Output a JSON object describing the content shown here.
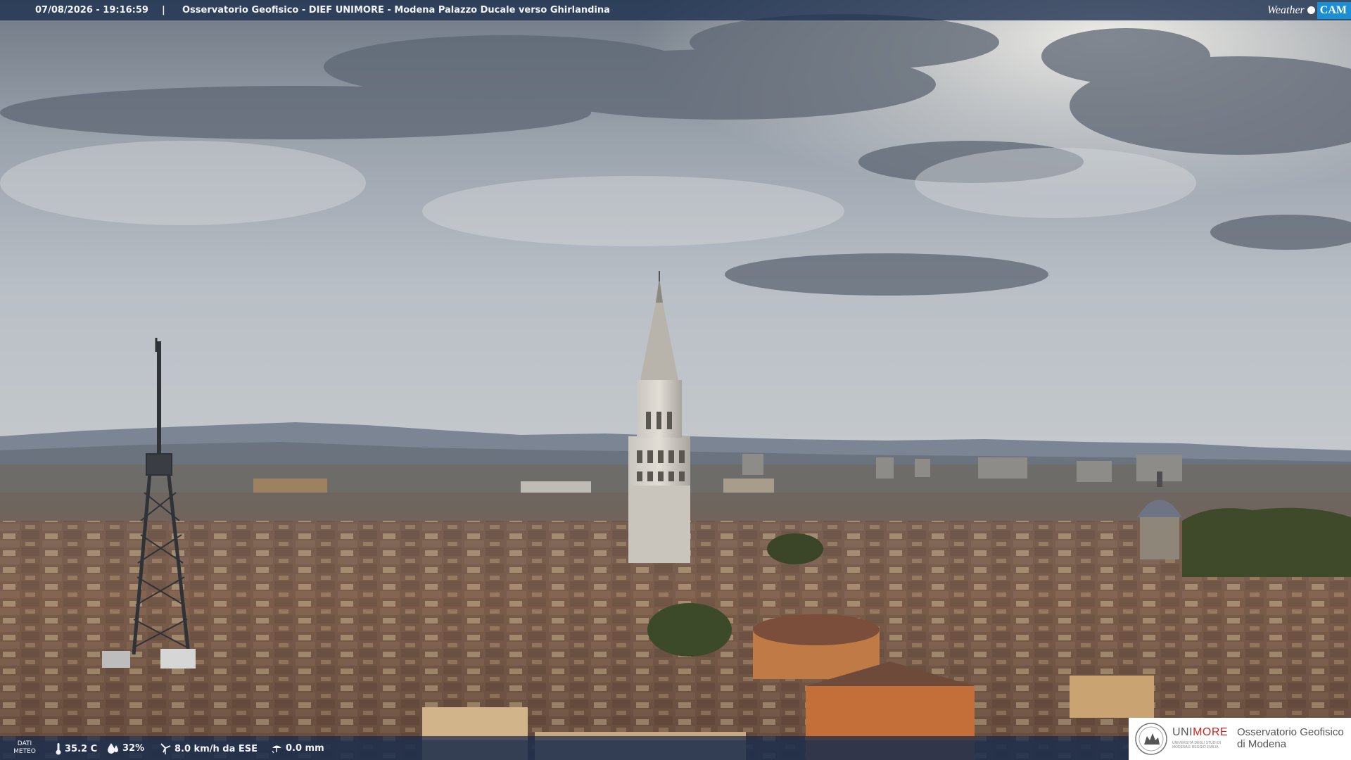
{
  "overlay": {
    "timestamp": "07/08/2026 - 19:16:59",
    "separator": "|",
    "location": "Osservatorio Geofisico - DIEF UNIMORE - Modena Palazzo Ducale verso Ghirlandina"
  },
  "brand": {
    "weather": "Weather",
    "cam": "CAM"
  },
  "meteo": {
    "label_line1": "DATI",
    "label_line2": "METEO",
    "temperature": "35.2 C",
    "humidity": "32%",
    "wind": "8.0 km/h da ESE",
    "rain": "0.0 mm"
  },
  "logo": {
    "uni_part1": "UNI",
    "uni_part2": "MORE",
    "uni_sub": "UNIVERSITÀ DEGLI STUDI DI MODENA E REGGIO EMILIA",
    "obs_line1": "Osservatorio Geofisico",
    "obs_line2": "di Modena"
  },
  "colors": {
    "accent_blue": "#1a8fd6",
    "unimore_red": "#c8271f"
  },
  "icons": [
    "thermometer-icon",
    "humidity-drop-icon",
    "wind-turbine-icon",
    "rain-icon"
  ]
}
